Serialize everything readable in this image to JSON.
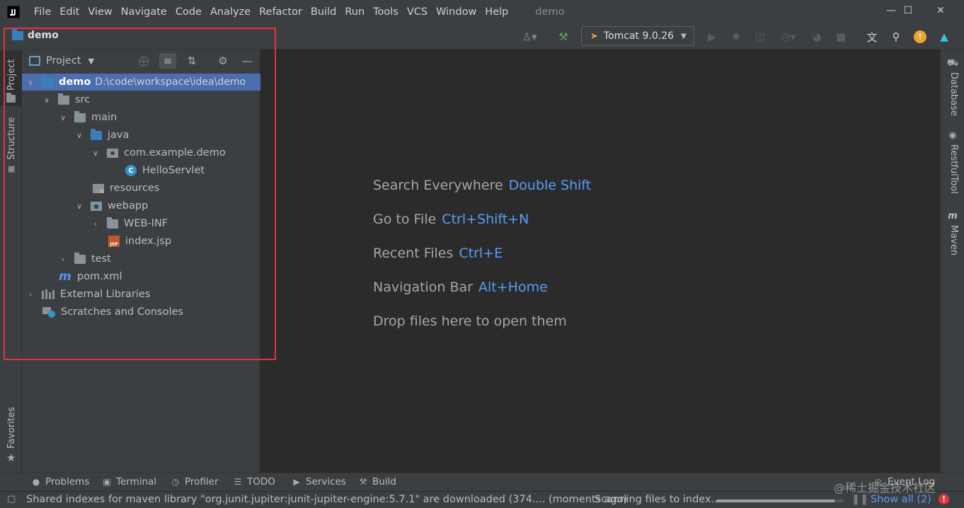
{
  "menubar": {
    "items": [
      "File",
      "Edit",
      "View",
      "Navigate",
      "Code",
      "Analyze",
      "Refactor",
      "Build",
      "Run",
      "Tools",
      "VCS",
      "Window",
      "Help"
    ],
    "window_title": "demo"
  },
  "toolbar": {
    "project_crumb": "demo",
    "run_config": "Tomcat 9.0.26"
  },
  "left_stripe": {
    "tabs": [
      "Project",
      "Structure",
      "Favorites"
    ]
  },
  "project_panel": {
    "title": "Project",
    "tree": [
      {
        "label": "demo",
        "path": "D:\\code\\workspace\\idea\\demo"
      },
      {
        "label": "src"
      },
      {
        "label": "main"
      },
      {
        "label": "java"
      },
      {
        "label": "com.example.demo"
      },
      {
        "label": "HelloServlet",
        "icon_letter": "C"
      },
      {
        "label": "resources"
      },
      {
        "label": "webapp"
      },
      {
        "label": "WEB-INF"
      },
      {
        "label": "index.jsp",
        "icon_letter": "JSP"
      },
      {
        "label": "test"
      },
      {
        "label": "pom.xml",
        "icon_letter": "m"
      },
      {
        "label": "External Libraries"
      },
      {
        "label": "Scratches and Consoles"
      }
    ]
  },
  "editor": {
    "hints": [
      {
        "text": "Search Everywhere",
        "key": "Double Shift"
      },
      {
        "text": "Go to File",
        "key": "Ctrl+Shift+N"
      },
      {
        "text": "Recent Files",
        "key": "Ctrl+E"
      },
      {
        "text": "Navigation Bar",
        "key": "Alt+Home"
      },
      {
        "text": "Drop files here to open them",
        "key": ""
      }
    ]
  },
  "right_stripe": {
    "tabs": [
      "Database",
      "RestfulTool",
      "Maven"
    ]
  },
  "bottom_bar": {
    "items": [
      "Problems",
      "Terminal",
      "Profiler",
      "TODO",
      "Services",
      "Build"
    ],
    "event_log": "Event Log"
  },
  "status_bar": {
    "message": "Shared indexes for maven library \"org.junit.jupiter:junit-jupiter-engine:5.7.1\" are downloaded (374.... (moments ago)",
    "progress_label": "Scanning files to index...",
    "progress_fraction": 0.93,
    "show_all": "Show all (2)"
  },
  "watermark": "@稀土掘金技术社区",
  "colors": {
    "accent": "#589df6",
    "selection": "#4b6eaf",
    "highlight_box": "#e0353a",
    "panel_bg": "#3c3f41",
    "editor_bg": "#2b2b2b"
  },
  "icons": {
    "toolbar": [
      "user-icon",
      "hammer-icon",
      "tomcat-icon",
      "run-icon",
      "debug-icon",
      "coverage-icon",
      "profile-icon",
      "build-icon",
      "stop-icon",
      "translate-icon",
      "search-icon",
      "update-icon",
      "toolbox-icon"
    ]
  }
}
